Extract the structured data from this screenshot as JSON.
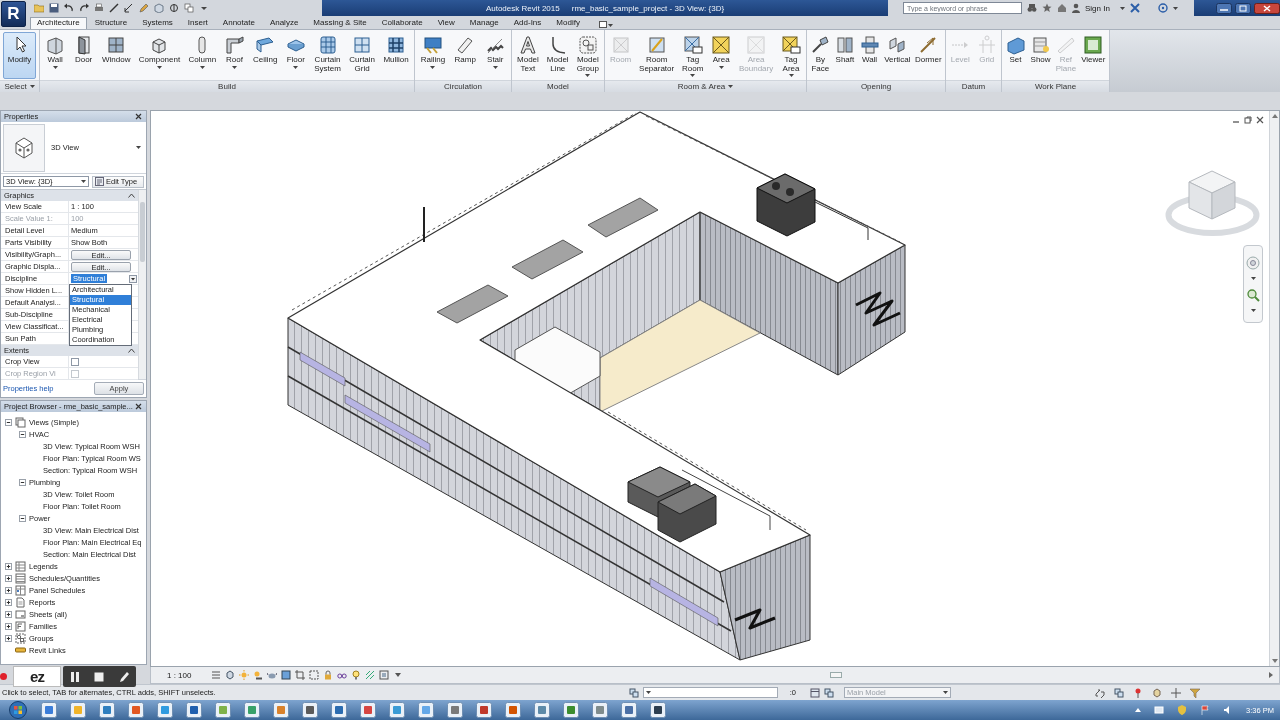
{
  "app_menu": {
    "label": "R"
  },
  "window": {
    "product": "Autodesk Revit 2015",
    "title": "rme_basic_sample_project - 3D View: {3D}"
  },
  "search": {
    "placeholder": "Type a keyword or phrase"
  },
  "account": {
    "label": "Sign In"
  },
  "tabs": [
    {
      "label": "Architecture",
      "selected": true
    },
    {
      "label": "Structure",
      "selected": false
    },
    {
      "label": "Systems",
      "selected": false
    },
    {
      "label": "Insert",
      "selected": false
    },
    {
      "label": "Annotate",
      "selected": false
    },
    {
      "label": "Analyze",
      "selected": false
    },
    {
      "label": "Massing & Site",
      "selected": false
    },
    {
      "label": "Collaborate",
      "selected": false
    },
    {
      "label": "View",
      "selected": false
    },
    {
      "label": "Manage",
      "selected": false
    },
    {
      "label": "Add-Ins",
      "selected": false
    },
    {
      "label": "Modify",
      "selected": false
    }
  ],
  "ribbon": {
    "panels": [
      {
        "title": "Select",
        "has_menu": true,
        "tools": [
          {
            "label": "Modify",
            "selected": true,
            "disabled": false,
            "dropdown": false
          }
        ]
      },
      {
        "title": "Build",
        "has_menu": false,
        "tools": [
          {
            "label": "Wall",
            "selected": false,
            "disabled": false,
            "dropdown": true
          },
          {
            "label": "Door",
            "selected": false,
            "disabled": false,
            "dropdown": false
          },
          {
            "label": "Window",
            "selected": false,
            "disabled": false,
            "dropdown": false
          },
          {
            "label": "Component",
            "selected": false,
            "disabled": false,
            "dropdown": true
          },
          {
            "label": "Column",
            "selected": false,
            "disabled": false,
            "dropdown": true
          },
          {
            "label": "Roof",
            "selected": false,
            "disabled": false,
            "dropdown": true
          },
          {
            "label": "Ceiling",
            "selected": false,
            "disabled": false,
            "dropdown": false
          },
          {
            "label": "Floor",
            "selected": false,
            "disabled": false,
            "dropdown": true
          },
          {
            "label": "Curtain System",
            "selected": false,
            "disabled": false,
            "dropdown": false
          },
          {
            "label": "Curtain Grid",
            "selected": false,
            "disabled": false,
            "dropdown": false
          },
          {
            "label": "Mullion",
            "selected": false,
            "disabled": false,
            "dropdown": false
          }
        ]
      },
      {
        "title": "Circulation",
        "has_menu": false,
        "tools": [
          {
            "label": "Railing",
            "selected": false,
            "disabled": false,
            "dropdown": true
          },
          {
            "label": "Ramp",
            "selected": false,
            "disabled": false,
            "dropdown": false
          },
          {
            "label": "Stair",
            "selected": false,
            "disabled": false,
            "dropdown": true
          }
        ]
      },
      {
        "title": "Model",
        "has_menu": false,
        "tools": [
          {
            "label": "Model Text",
            "selected": false,
            "disabled": false,
            "dropdown": false
          },
          {
            "label": "Model Line",
            "selected": false,
            "disabled": false,
            "dropdown": false
          },
          {
            "label": "Model Group",
            "selected": false,
            "disabled": false,
            "dropdown": true
          }
        ]
      },
      {
        "title": "Room & Area",
        "has_menu": true,
        "tools": [
          {
            "label": "Room",
            "selected": false,
            "disabled": true,
            "dropdown": false
          },
          {
            "label": "Room Separator",
            "selected": false,
            "disabled": false,
            "dropdown": false
          },
          {
            "label": "Tag Room",
            "selected": false,
            "disabled": false,
            "dropdown": true
          },
          {
            "label": "Area",
            "selected": false,
            "disabled": false,
            "dropdown": true
          },
          {
            "label": "Area Boundary",
            "selected": false,
            "disabled": true,
            "dropdown": false
          },
          {
            "label": "Tag Area",
            "selected": false,
            "disabled": false,
            "dropdown": true
          }
        ]
      },
      {
        "title": "Opening",
        "has_menu": false,
        "tools": [
          {
            "label": "By Face",
            "selected": false,
            "disabled": false,
            "dropdown": false
          },
          {
            "label": "Shaft",
            "selected": false,
            "disabled": false,
            "dropdown": false
          },
          {
            "label": "Wall",
            "selected": false,
            "disabled": false,
            "dropdown": false
          },
          {
            "label": "Vertical",
            "selected": false,
            "disabled": false,
            "dropdown": false
          },
          {
            "label": "Dormer",
            "selected": false,
            "disabled": false,
            "dropdown": false
          }
        ]
      },
      {
        "title": "Datum",
        "has_menu": false,
        "tools": [
          {
            "label": "Level",
            "selected": false,
            "disabled": true,
            "dropdown": false
          },
          {
            "label": "Grid",
            "selected": false,
            "disabled": true,
            "dropdown": false
          }
        ]
      },
      {
        "title": "Work Plane",
        "has_menu": false,
        "tools": [
          {
            "label": "Set",
            "selected": false,
            "disabled": false,
            "dropdown": false
          },
          {
            "label": "Show",
            "selected": false,
            "disabled": false,
            "dropdown": false
          },
          {
            "label": "Ref Plane",
            "selected": false,
            "disabled": true,
            "dropdown": false
          },
          {
            "label": "Viewer",
            "selected": false,
            "disabled": false,
            "dropdown": false
          }
        ]
      }
    ]
  },
  "properties": {
    "title": "Properties",
    "type_name": "3D View",
    "instance": "3D View: {3D}",
    "edit_type": "Edit Type",
    "groups": [
      {
        "title": "Graphics",
        "expanded": true,
        "rows": [
          {
            "kind": "text",
            "name": "View Scale",
            "value": "1 : 100",
            "disabled": false
          },
          {
            "kind": "text",
            "name": "Scale Value  1:",
            "value": "100",
            "disabled": true
          },
          {
            "kind": "text",
            "name": "Detail Level",
            "value": "Medium",
            "disabled": false
          },
          {
            "kind": "text",
            "name": "Parts Visibility",
            "value": "Show Both",
            "disabled": false
          },
          {
            "kind": "button",
            "name": "Visibility/Graph...",
            "value": "Edit...",
            "disabled": false
          },
          {
            "kind": "button",
            "name": "Graphic Displa...",
            "value": "Edit...",
            "disabled": false
          },
          {
            "kind": "combo",
            "name": "Discipline",
            "value": "Structural",
            "disabled": false,
            "open": true,
            "options": [
              {
                "label": "Architectural",
                "selected": false
              },
              {
                "label": "Structural",
                "selected": true
              },
              {
                "label": "Mechanical",
                "selected": false
              },
              {
                "label": "Electrical",
                "selected": false
              },
              {
                "label": "Plumbing",
                "selected": false
              },
              {
                "label": "Coordination",
                "selected": false
              }
            ]
          },
          {
            "kind": "text",
            "name": "Show Hidden L...",
            "disabled": false
          },
          {
            "kind": "text",
            "name": "Default Analysi...",
            "disabled": false
          },
          {
            "kind": "text",
            "name": "Sub-Discipline",
            "disabled": false
          },
          {
            "kind": "text",
            "name": "View Classificat...",
            "disabled": false
          },
          {
            "kind": "text",
            "name": "Sun Path",
            "disabled": false
          }
        ]
      },
      {
        "title": "Extents",
        "expanded": true,
        "rows": [
          {
            "kind": "checkbox",
            "name": "Crop View",
            "checked": false,
            "disabled": false
          },
          {
            "kind": "checkbox",
            "name": "Crop Region Vi",
            "checked": false,
            "disabled": true
          }
        ]
      }
    ],
    "help": "Properties help",
    "apply": "Apply"
  },
  "project_browser": {
    "title": "Project Browser - rme_basic_sample...",
    "tree": [
      {
        "label": "Views (Simple)",
        "expanded": true,
        "children": [
          {
            "label": "HVAC",
            "expanded": true,
            "children": [
              {
                "label": "3D View: Typical Room WSH"
              },
              {
                "label": "Floor Plan: Typical Room WS"
              },
              {
                "label": "Section: Typical Room WSH"
              }
            ]
          },
          {
            "label": "Plumbing",
            "expanded": true,
            "children": [
              {
                "label": "3D View: Toilet Room"
              },
              {
                "label": "Floor Plan: Toilet Room"
              }
            ]
          },
          {
            "label": "Power",
            "expanded": true,
            "children": [
              {
                "label": "3D View: Main Electrical Dist"
              },
              {
                "label": "Floor Plan: Main Electrical Eq"
              },
              {
                "label": "Section: Main Electrical Dist"
              }
            ]
          }
        ]
      },
      {
        "label": "Legends",
        "expanded": false
      },
      {
        "label": "Schedules/Quantities",
        "expanded": false
      },
      {
        "label": "Panel Schedules",
        "expanded": false
      },
      {
        "label": "Reports",
        "expanded": false
      },
      {
        "label": "Sheets (all)",
        "expanded": false
      },
      {
        "label": "Families",
        "expanded": false
      },
      {
        "label": "Groups",
        "expanded": false
      },
      {
        "label": "Revit Links"
      }
    ]
  },
  "view_control_bar": {
    "scale": "1 : 100"
  },
  "status_bar": {
    "message": "Click to select, TAB for alternates, CTRL adds, SHIFT unselects.",
    "active_only": ":0",
    "design_option": {
      "value": "Main Model",
      "disabled": true
    }
  },
  "recorder": {
    "logo": "ez"
  },
  "taskbar": {
    "clock": "3:36 PM"
  }
}
